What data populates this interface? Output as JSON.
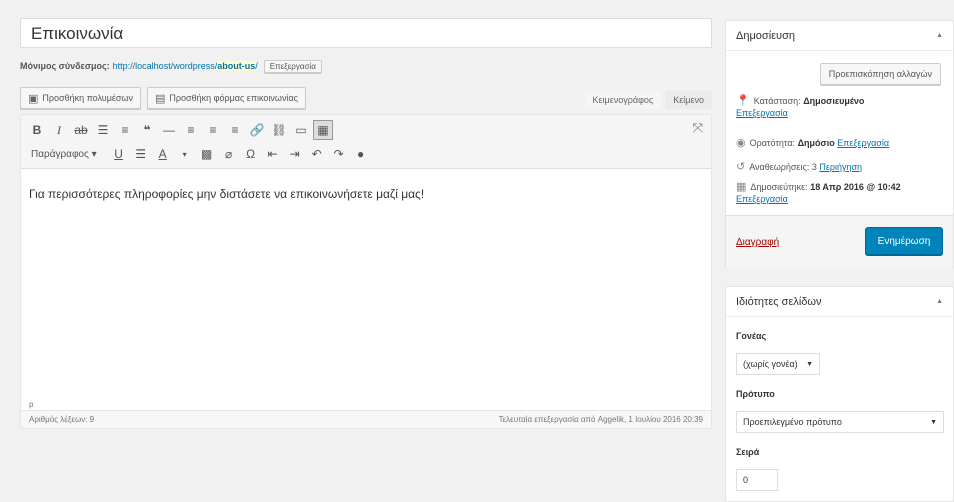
{
  "title": "Επικοινωνία",
  "permalink": {
    "label": "Μόνιμος σύνδεσμος:",
    "url_prefix": "http://localhost/wordpress/",
    "slug": "about-us",
    "url_suffix": "/",
    "edit_button": "Επεξεργασία"
  },
  "media": {
    "add_media": "Προσθήκη πολυμέσων",
    "add_form": "Προσθήκη φόρμας επικοινωνίας"
  },
  "tabs": {
    "visual": "Κειμενογράφος",
    "text": "Κείμενο"
  },
  "toolbar": {
    "format_select": "Παράγραφος"
  },
  "editor": {
    "content": "Για περισσότερες πληροφορίες μην διστάσετε να επικοινωνήσετε μαζί μας!",
    "path": "p",
    "word_count": "Αριθμός λέξεων: 9",
    "last_edited": "Τελευταία επεξεργασία από Aggelik, 1 Ιουλίου 2016 20:39"
  },
  "publish": {
    "title": "Δημοσίευση",
    "preview_button": "Προεπισκόπηση αλλαγών",
    "status_label": "Κατάσταση:",
    "status_value": "Δημοσιευμένο",
    "status_edit": "Επεξεργασία",
    "visibility_label": "Ορατότητα:",
    "visibility_value": "Δημόσιο",
    "visibility_edit": "Επεξεργασία",
    "revisions_label": "Αναθεωρήσεις: 3",
    "revisions_link": "Περιήγηση",
    "published_label": "Δημοσιεύτηκε:",
    "published_value": "18 Απρ 2016 @ 10:42",
    "published_edit": "Επεξεργασία",
    "delete_link": "Διαγραφή",
    "update_button": "Ενημέρωση"
  },
  "page_attributes": {
    "title": "Ιδιότητες σελίδων",
    "parent_label": "Γονέας",
    "parent_value": "(χωρίς γονέα)",
    "template_label": "Πρότυπο",
    "template_value": "Προεπιλεγμένο πρότυπο",
    "order_label": "Σειρά",
    "order_value": "0"
  },
  "colors": {
    "accent": "#0085ba",
    "link": "#0073aa",
    "delete": "#aa0000"
  }
}
